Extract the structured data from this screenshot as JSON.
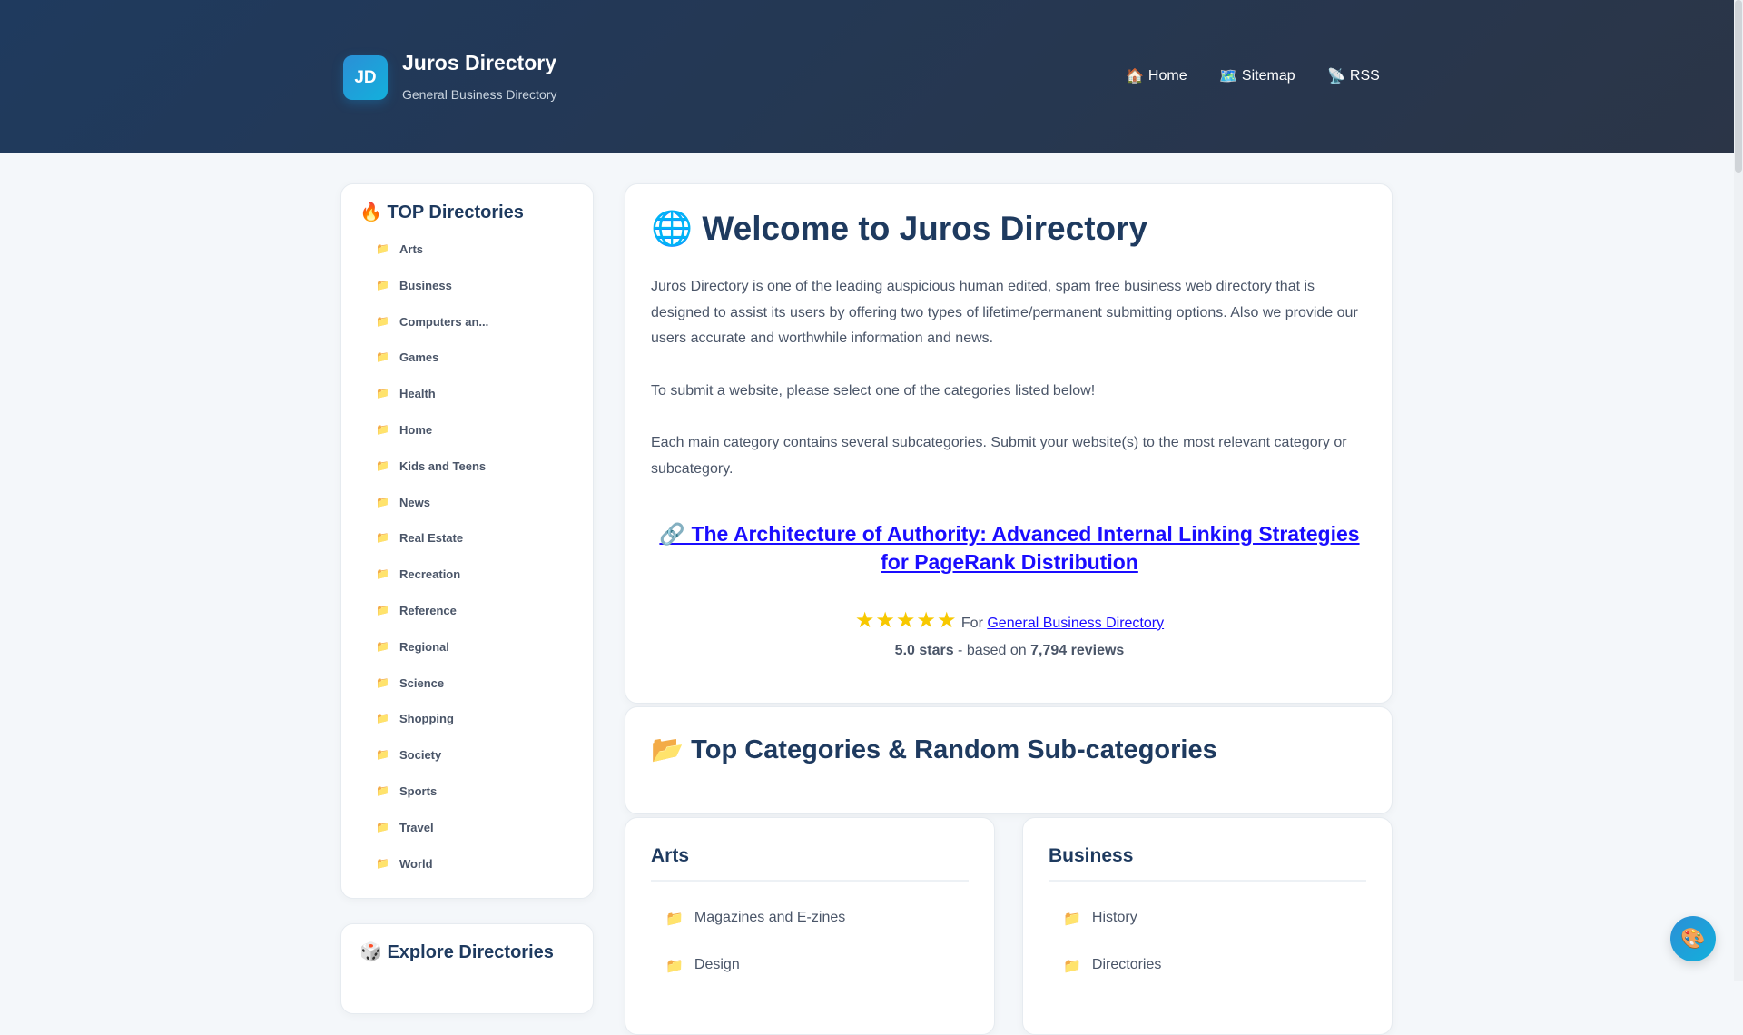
{
  "header": {
    "logo": "JD",
    "title": "Juros Directory",
    "subtitle": "General Business Directory",
    "nav": [
      {
        "icon": "🏠",
        "label": "Home"
      },
      {
        "icon": "🗺️",
        "label": "Sitemap"
      },
      {
        "icon": "📡",
        "label": "RSS"
      }
    ]
  },
  "sidebar": {
    "top_icon": "🔥",
    "top_title": "TOP Directories",
    "items": [
      "Arts",
      "Business",
      "Computers an...",
      "Games",
      "Health",
      "Home",
      "Kids and Teens",
      "News",
      "Real Estate",
      "Recreation",
      "Reference",
      "Regional",
      "Science",
      "Shopping",
      "Society",
      "Sports",
      "Travel",
      "World"
    ],
    "explore_icon": "🎲",
    "explore_title": "Explore Directories"
  },
  "welcome": {
    "icon": "🌐",
    "title": "Welcome to Juros Directory",
    "p1": "Juros Directory is one of the leading auspicious human edited, spam free business web directory that is designed to assist its users by offering two types of lifetime/permanent submitting options. Also we provide our users accurate and worthwhile information and news.",
    "p2": "To submit a website, please select one of the categories listed below!",
    "p3": "Each main category contains several subcategories. Submit your website(s) to the most relevant category or subcategory.",
    "featured_link": "🔗 The Architecture of Authority: Advanced Internal Linking Strategies for PageRank Distribution",
    "stars": "★★★★★",
    "for_label": "For",
    "for_link": "General Business Directory",
    "rating_value": "5.0 stars",
    "rating_mid": " - based on ",
    "review_count": "7,794 reviews"
  },
  "categories": {
    "icon": "📂",
    "title": "Top Categories & Random Sub-categories",
    "cards": [
      {
        "title": "Arts",
        "items": [
          "Magazines and E-zines",
          "Design"
        ]
      },
      {
        "title": "Business",
        "items": [
          "History",
          "Directories"
        ]
      }
    ]
  },
  "theme_button_icon": "🎨"
}
